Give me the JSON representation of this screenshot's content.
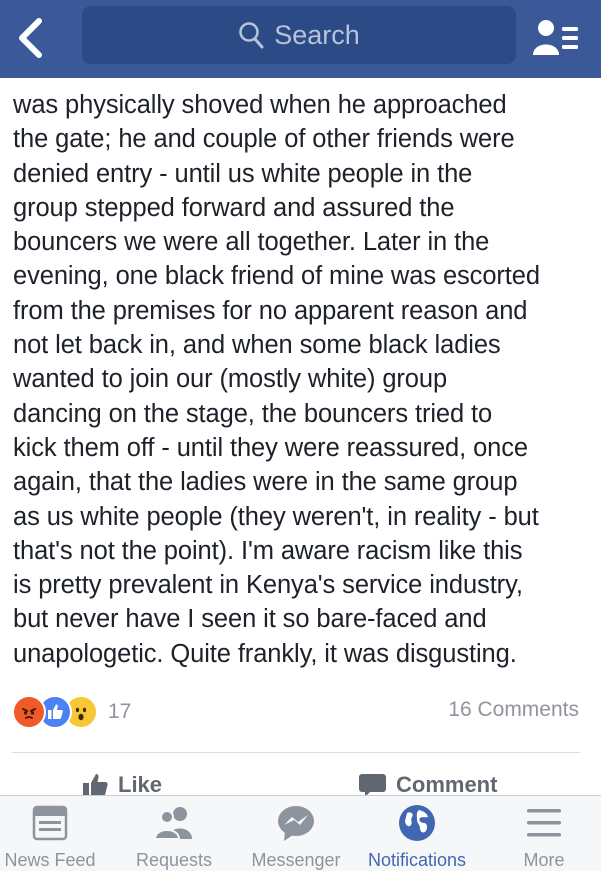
{
  "topbar": {
    "search_placeholder": "Search"
  },
  "post": {
    "lines": [
      "was physically shoved when he approached",
      "the gate; he and couple of other friends were",
      "denied entry - until us white people in the",
      "group stepped forward and assured the",
      "bouncers we were all together. Later in the",
      "evening, one black friend of mine was escorted",
      "from the premises for no apparent reason and",
      "not let back in, and when some black ladies",
      "wanted to join our (mostly white) group",
      "dancing on the stage, the bouncers tried to",
      "kick them off - until they were reassured, once",
      "again, that the ladies were in the same group",
      "as us white people (they weren't, in reality - but",
      "that's not the point). I'm aware racism like this",
      "is pretty prevalent in Kenya's service industry,",
      "but never have I seen it so bare-faced and",
      "unapologetic. Quite frankly, it was disgusting."
    ]
  },
  "reactions": {
    "icons": [
      "angry-icon",
      "like-icon",
      "wow-icon"
    ],
    "count": "17",
    "comments": "16 Comments"
  },
  "actions": {
    "like": "Like",
    "comment": "Comment"
  },
  "tabs": [
    {
      "label": "News Feed",
      "icon": "news-feed-icon"
    },
    {
      "label": "Requests",
      "icon": "friend-requests-icon"
    },
    {
      "label": "Messenger",
      "icon": "messenger-icon"
    },
    {
      "label": "Notifications",
      "icon": "globe-icon",
      "active": true
    },
    {
      "label": "More",
      "icon": "menu-icon"
    }
  ],
  "colors": {
    "brand": "#3b5998",
    "active_tab": "#4267b2",
    "muted": "#90949c"
  }
}
